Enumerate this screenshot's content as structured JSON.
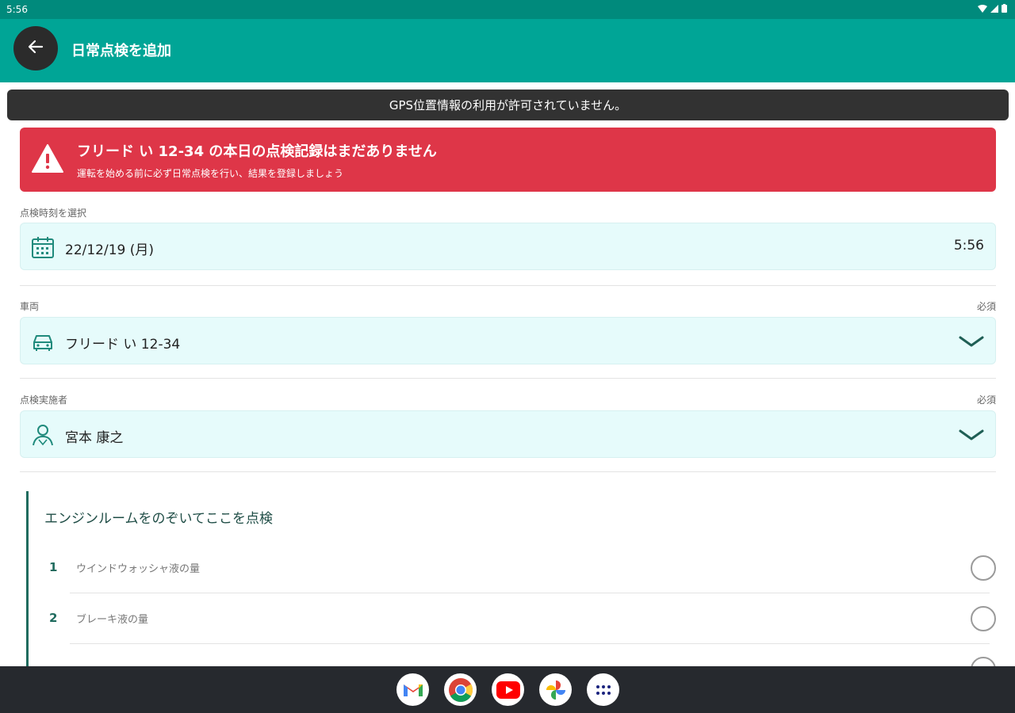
{
  "status_bar": {
    "time": "5:56"
  },
  "app_bar": {
    "title": "日常点検を追加"
  },
  "gps_banner": {
    "text": "GPS位置情報の利用が許可されていません。"
  },
  "alert": {
    "title": "フリード い 12-34 の本日の点検記録はまだありません",
    "subtitle": "運転を始める前に必ず日常点検を行い、結果を登録しましょう"
  },
  "datetime_field": {
    "label": "点検時刻を選択",
    "date": "22/12/19 (月)",
    "time": "5:56"
  },
  "vehicle_field": {
    "label": "車両",
    "required": "必須",
    "value": "フリード い 12-34"
  },
  "inspector_field": {
    "label": "点検実施者",
    "required": "必須",
    "value": "宮本 康之"
  },
  "checklist": {
    "title": "エンジンルームをのぞいてここを点検",
    "items": [
      {
        "num": "1",
        "label": "ウインドウォッシャ液の量"
      },
      {
        "num": "2",
        "label": "ブレーキ液の量"
      }
    ]
  },
  "colors": {
    "appbar": "#00a596",
    "statusbar": "#008a7c",
    "alert": "#de3648",
    "field_bg": "#e6fbfb",
    "accent": "#1f6b5e"
  },
  "dock": [
    "gmail-icon",
    "chrome-icon",
    "youtube-icon",
    "photos-icon",
    "app-drawer-icon"
  ]
}
